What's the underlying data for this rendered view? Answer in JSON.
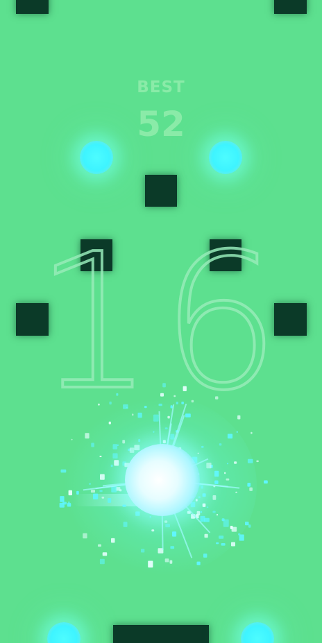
{
  "hud": {
    "best_label": "BEST",
    "best_value": "52",
    "score": "16"
  },
  "colors": {
    "background": "#5de08f",
    "block": "#0b3a28",
    "orb": "#3ef4ff",
    "player": "#ffffff",
    "text": "#8cebaa"
  },
  "icons": {
    "orb": "glowing-orb-icon",
    "player": "player-ball-icon",
    "obstacle": "square-block-icon"
  }
}
